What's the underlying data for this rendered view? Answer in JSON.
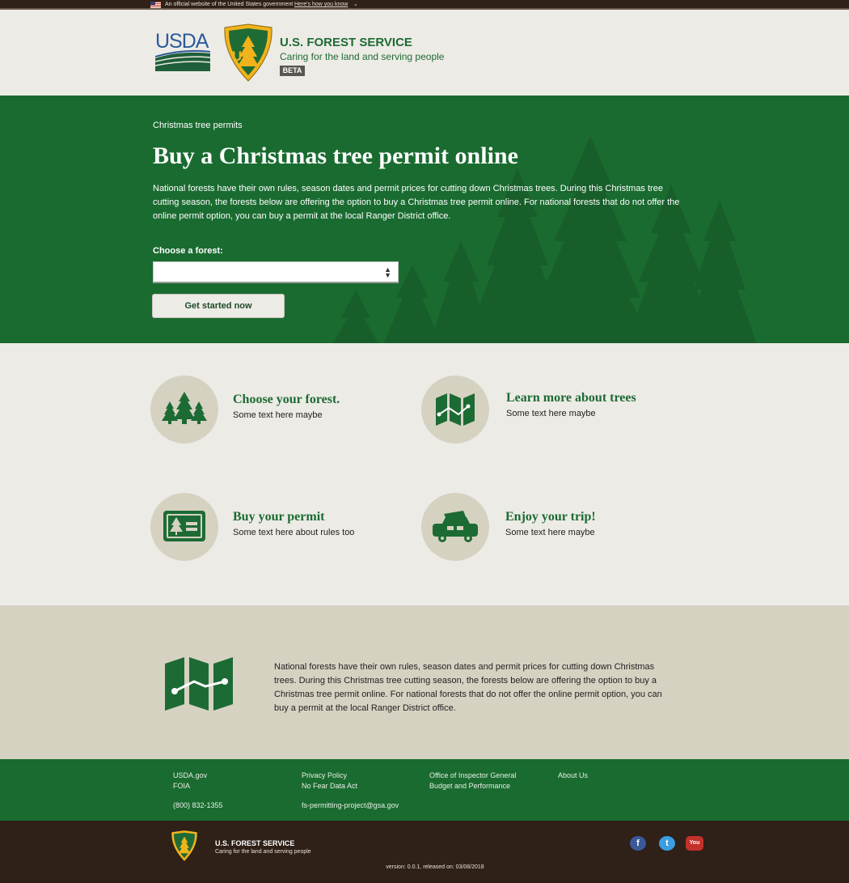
{
  "gov_banner": {
    "text": "An official website of the United States government",
    "link": "Here's how you know",
    "chevron": "⌄"
  },
  "header": {
    "usda_text": "USDA",
    "agency_name": "U.S. FOREST SERVICE",
    "tagline": "Caring for the land and serving people",
    "badge": "BETA",
    "shield_text": "US"
  },
  "hero": {
    "breadcrumb": "Christmas tree permits",
    "title": "Buy a Christmas tree permit online",
    "description": "National forests have their own rules, season dates and permit prices for cutting down Christmas trees. During this Christmas tree cutting season, the forests below are offering the option to buy a Christmas tree permit online. For national forests that do not offer the online permit option, you can buy a permit at the local Ranger District office.",
    "choose_label": "Choose a forest:",
    "select_value": "",
    "select_arrows": "▲▼",
    "button_label": "Get started now"
  },
  "features": [
    {
      "title": "Choose your forest.",
      "text": "Some text here maybe",
      "icon": "trees-icon"
    },
    {
      "title": "Learn more about trees",
      "text": "Some text here maybe",
      "icon": "map-icon"
    },
    {
      "title": "Buy your permit",
      "text": "Some text here about rules too",
      "icon": "permit-card-icon"
    },
    {
      "title": "Enjoy your trip!",
      "text": "Some text here maybe",
      "icon": "car-with-tree-icon"
    }
  ],
  "info": {
    "text": "National forests have their own rules, season dates and permit prices for cutting down Christmas trees. During this Christmas tree cutting season, the forests below are offering the option to buy a Christmas tree permit online. For national forests that do not offer the online permit option, you can buy a permit at the local Ranger District office."
  },
  "footer_links": {
    "usda": "USDA.gov",
    "foia": "FOIA",
    "phone": "(800) 832-1355",
    "privacy": "Privacy Policy",
    "no_fear": "No Fear Data Act",
    "email": "fs-permitting-project@gsa.gov",
    "oig": "Office of Inspector General",
    "budget": "Budget and Performance",
    "about": "About Us"
  },
  "bottom_footer": {
    "agency_name": "U.S. FOREST SERVICE",
    "tagline": "Caring for the land and serving people",
    "social": {
      "facebook": "f",
      "twitter": "t",
      "youtube": "You"
    },
    "version": "version: 0.0.1, released on: 03/08/2018"
  },
  "colors": {
    "brand_green": "#1a6b30",
    "dark_brown": "#2f2018",
    "beige": "#edebe6",
    "tan": "#d6d2c2"
  }
}
